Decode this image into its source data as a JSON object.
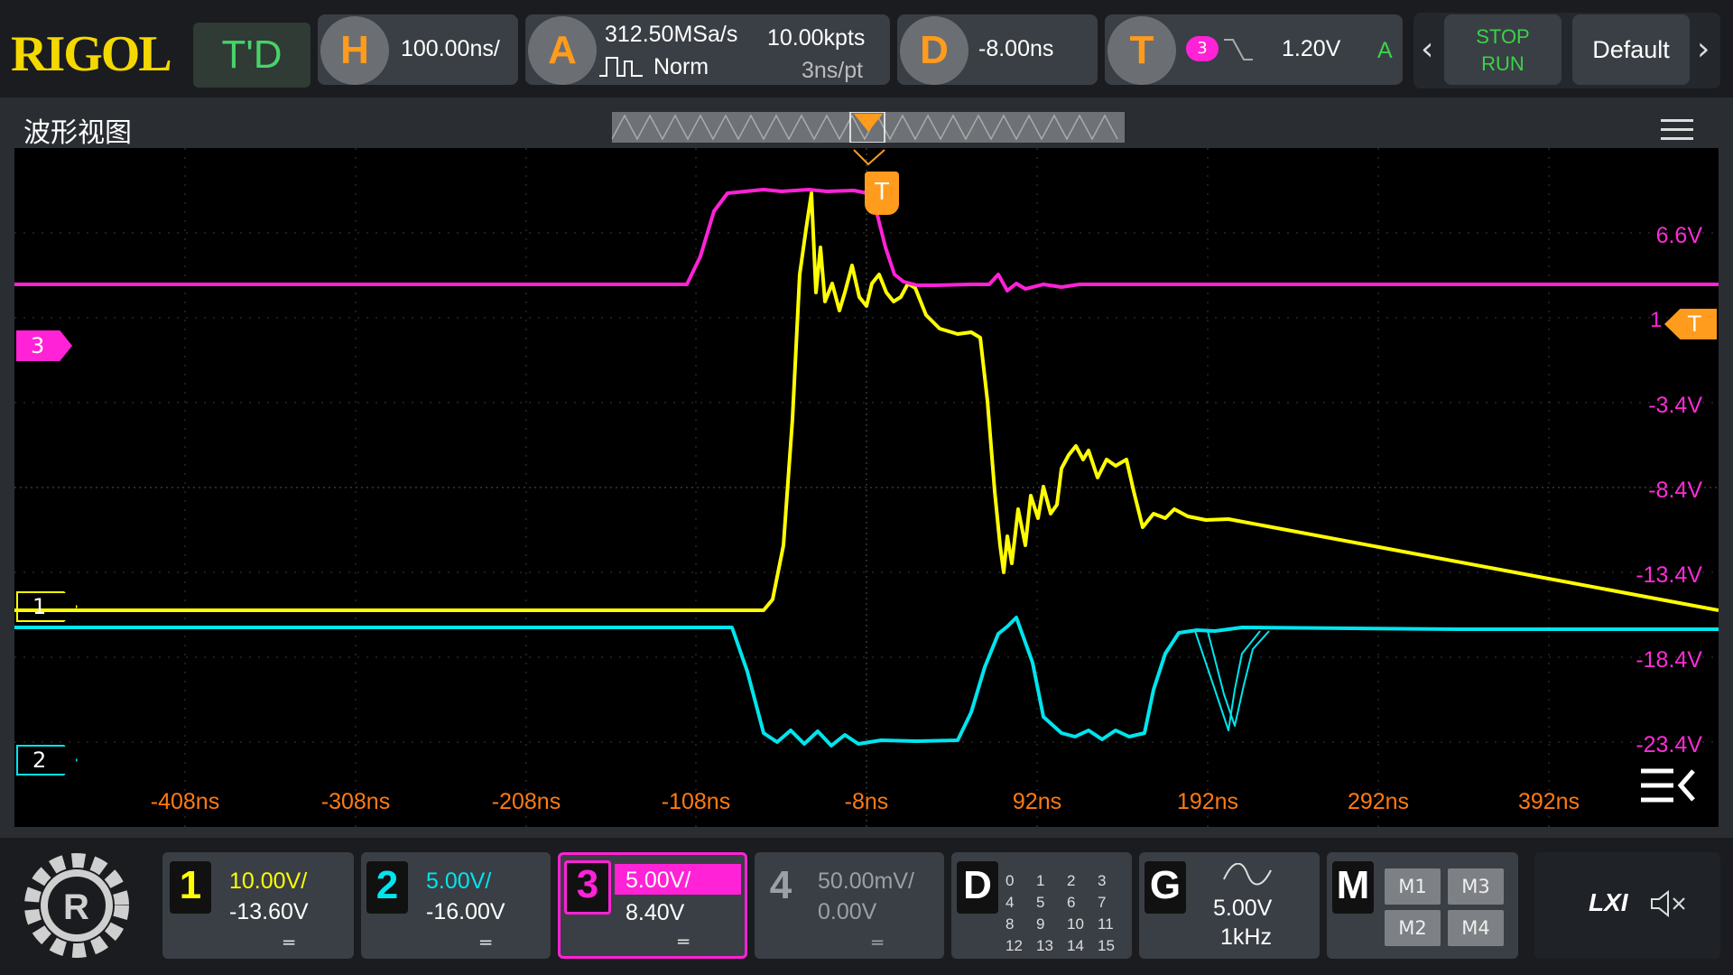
{
  "colors": {
    "ch1": "#ffff00",
    "ch2": "#00e5ee",
    "ch3": "#ff22d6",
    "ch4": "#9aa0a5",
    "accent": "#ff9b1d",
    "run": "#3bd24a"
  },
  "header": {
    "brand": "RIGOL",
    "mode": "T'D",
    "horizontal": {
      "letter": "H",
      "timebase": "100.00ns/"
    },
    "acquire": {
      "letter": "A",
      "sample_rate": "312.50MSa/s",
      "memory_depth": "10.00kpts",
      "mode": "Norm",
      "time_per_point": "3ns/pt"
    },
    "delay": {
      "letter": "D",
      "value": "-8.00ns"
    },
    "trigger": {
      "letter": "T",
      "source": "3",
      "level": "1.20V",
      "sweep": "A"
    },
    "stop_run": {
      "line1": "STOP",
      "line2": "RUN"
    },
    "default_label": "Default"
  },
  "waveform_view": {
    "title": "波形视图",
    "trigger_marker": "T",
    "trigger_level_marker": "T",
    "trigger_level_prefix": "1",
    "y_labels": [
      "6.6V",
      "1",
      "-3.4V",
      "-8.4V",
      "-13.4V",
      "-18.4V",
      "-23.4V"
    ],
    "x_labels": [
      "-408ns",
      "-308ns",
      "-208ns",
      "-108ns",
      "-8ns",
      "92ns",
      "192ns",
      "292ns",
      "392ns"
    ],
    "channel_markers": [
      "3",
      "1",
      "2"
    ]
  },
  "channels": [
    {
      "num": "1",
      "scale": "10.00V/",
      "offset": "-13.60V"
    },
    {
      "num": "2",
      "scale": "5.00V/",
      "offset": "-16.00V"
    },
    {
      "num": "3",
      "scale": "5.00V/",
      "offset": "8.40V"
    },
    {
      "num": "4",
      "scale": "50.00mV/",
      "offset": "0.00V"
    }
  ],
  "digital": {
    "letter": "D",
    "bits": [
      "0",
      "1",
      "2",
      "3",
      "4",
      "5",
      "6",
      "7",
      "8",
      "9",
      "10",
      "11",
      "12",
      "13",
      "14",
      "15"
    ]
  },
  "generator": {
    "letter": "G",
    "amplitude": "5.00V",
    "frequency": "1kHz"
  },
  "math": {
    "letter": "M",
    "items": [
      "M1",
      "M3",
      "M2",
      "M4"
    ]
  },
  "status": {
    "lxi": "LXI"
  }
}
